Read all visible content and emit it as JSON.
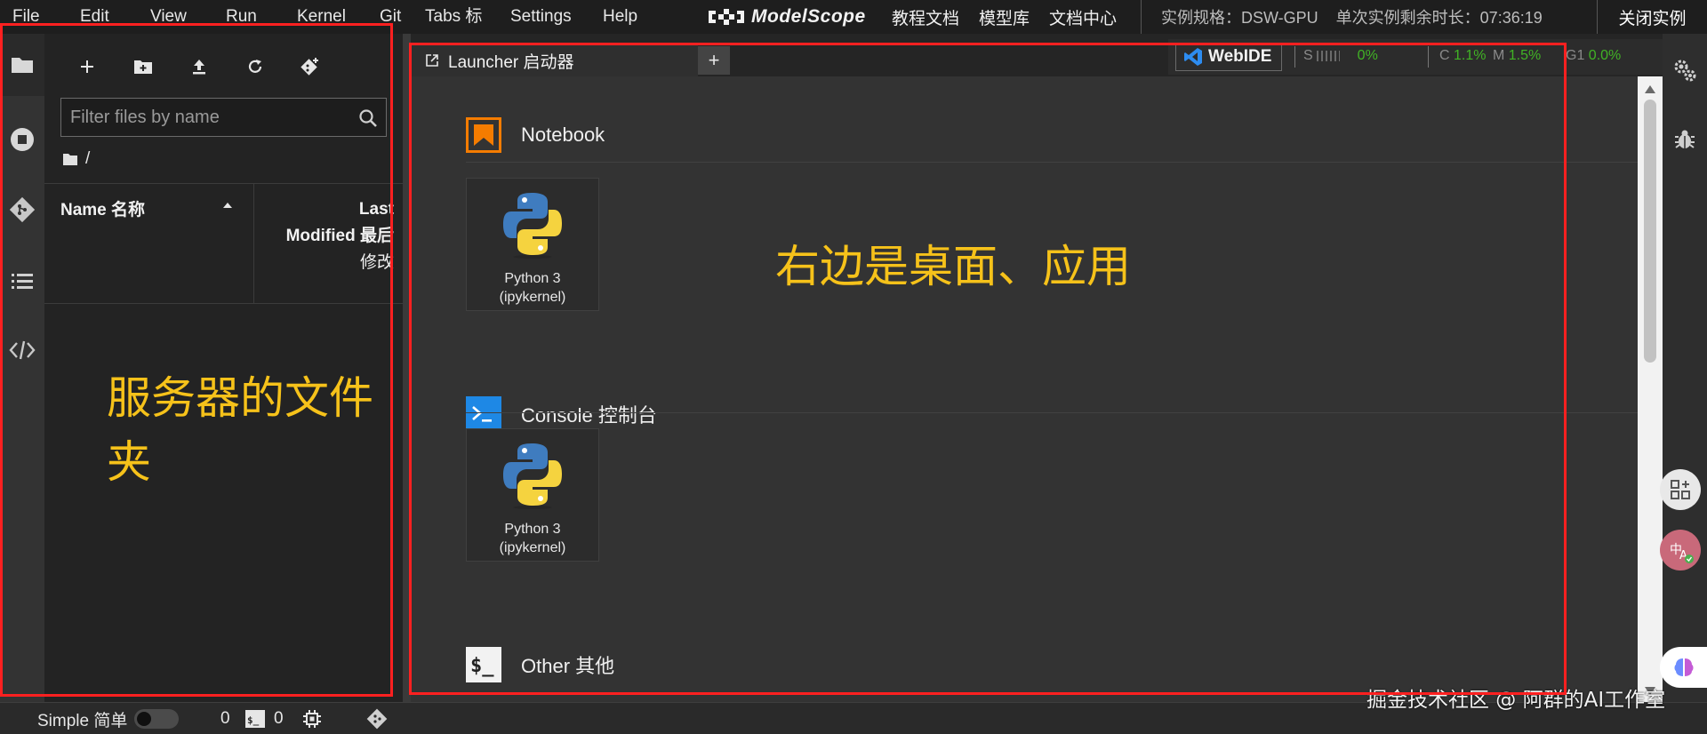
{
  "menu": {
    "items": [
      "File",
      "Edit",
      "View",
      "Run",
      "Kernel",
      "Git",
      "Tabs  标",
      "Settings",
      "Help"
    ]
  },
  "brand": {
    "logo_text": "ModelScope",
    "links": [
      "教程文档",
      "模型库",
      "文档中心"
    ]
  },
  "instance": {
    "spec": "实例规格：DSW-GPU",
    "remaining": "单次实例剩余时长：07:36:19",
    "close_label": "关闭实例"
  },
  "file_browser": {
    "filter_placeholder": "Filter files by name",
    "path": "/",
    "col_name": "Name  名称",
    "col_modified_line1": "Last",
    "col_modified_line2": "Modified  最后",
    "col_modified_line3": "修改"
  },
  "annotations": {
    "left": "服务器的文件夹",
    "right": "右边是桌面、应用"
  },
  "tabs": {
    "launcher_label": "Launcher  启动器",
    "add_symbol": "+"
  },
  "resources": {
    "webide_label": "WebIDE",
    "s_label": "S",
    "s_value": "0%",
    "c_label": "C",
    "c_value": "1.1%",
    "m_label": "M",
    "m_value": "1.5%",
    "g_label": "G1",
    "g_value": "0.0%"
  },
  "launcher": {
    "sections": [
      {
        "title": "Notebook",
        "card_line1": "Python 3",
        "card_line2": "(ipykernel)"
      },
      {
        "title": "Console  控制台",
        "card_line1": "Python 3",
        "card_line2": "(ipykernel)"
      },
      {
        "title": "Other  其他"
      }
    ]
  },
  "statusbar": {
    "simple_label": "Simple  简单",
    "kernels_count": "0",
    "terminals_count": "0"
  },
  "watermark": "掘金技术社区 @ 阿群的AI工作室",
  "colors": {
    "accent_annotation": "#f6c21a",
    "annotation_box": "#ff2020",
    "notebook_icon": "#f57c00",
    "console_icon": "#1e88e5",
    "metric_green": "#41b325"
  }
}
